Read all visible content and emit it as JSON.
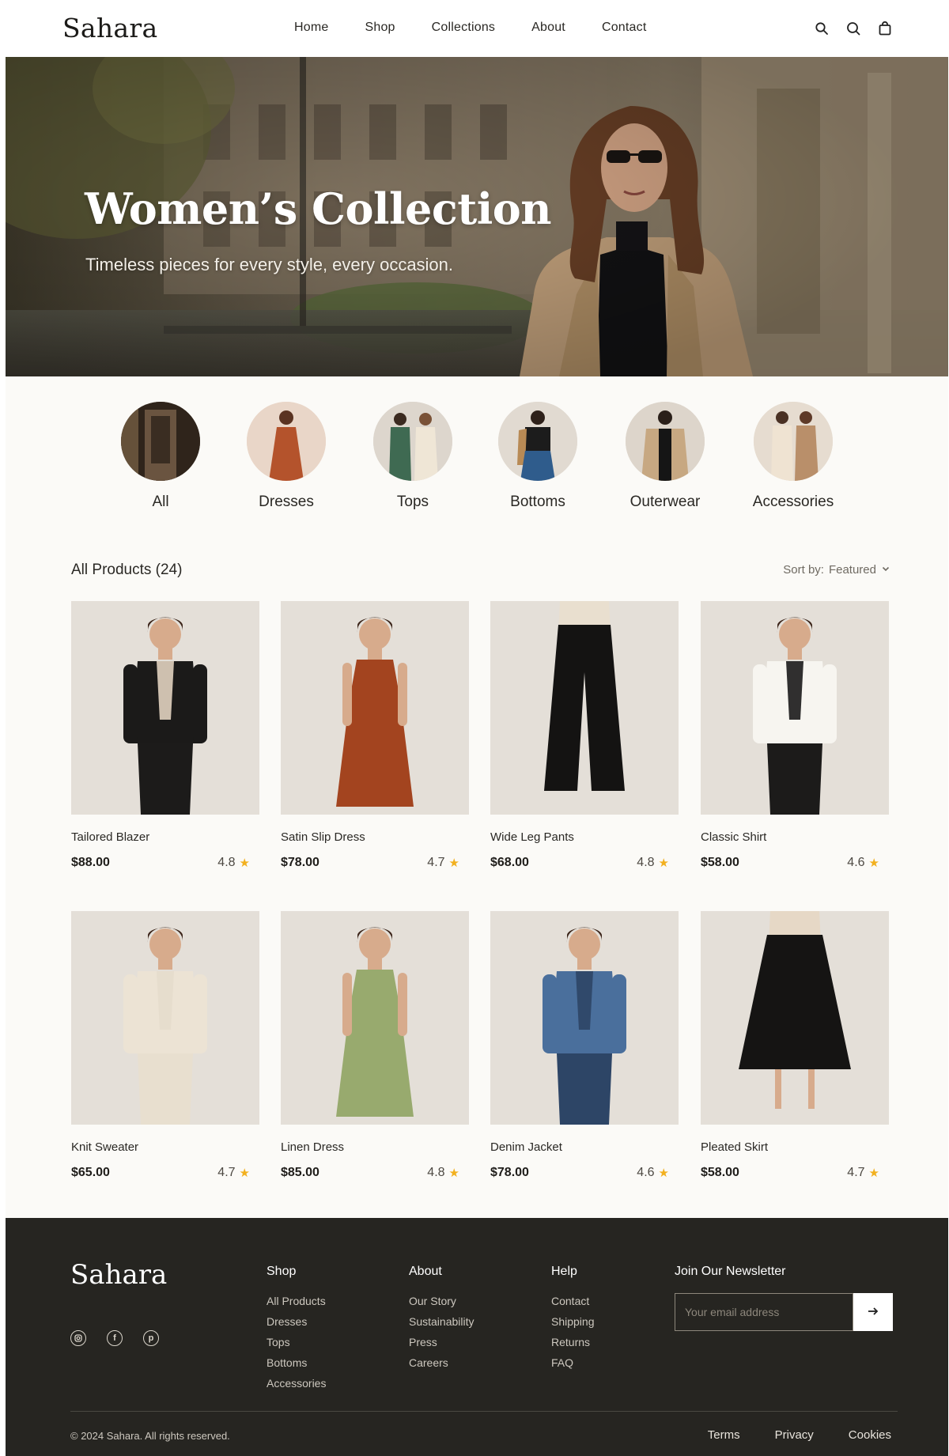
{
  "header": {
    "logo": "Sahara",
    "nav": [
      "Home",
      "Shop",
      "Collections",
      "About",
      "Contact"
    ],
    "icons": [
      "search-icon",
      "account-icon",
      "bag-icon"
    ]
  },
  "hero": {
    "title": "Women’s Collection",
    "subtitle": "Timeless pieces for every style, every occasion."
  },
  "categories": [
    {
      "label": "All",
      "image": "boutique-storefront",
      "color": "#4b3a2a"
    },
    {
      "label": "Dresses",
      "image": "rust-dress-model",
      "color": "#b4532c"
    },
    {
      "label": "Tops",
      "image": "green-and-cream-outfits",
      "color": "#3f6a52"
    },
    {
      "label": "Bottoms",
      "image": "blue-jeans-model",
      "color": "#2f5c8c"
    },
    {
      "label": "Outerwear",
      "image": "beige-coat-model",
      "color": "#c7a882"
    },
    {
      "label": "Accessories",
      "image": "neutral-outfits-model",
      "color": "#d8c4ab"
    }
  ],
  "products_header": {
    "count_label": "All Products (24)",
    "sort_label": "Sort by:",
    "sort_value": "Featured"
  },
  "products": [
    {
      "name": "Tailored Blazer",
      "price": "$88.00",
      "rating": "4.8",
      "image": "black-blazer-model",
      "color": "#1b1a19",
      "accent": "#e2d3c0"
    },
    {
      "name": "Satin Slip Dress",
      "price": "$78.00",
      "rating": "4.7",
      "image": "rust-slip-dress-model",
      "color": "#a3441f",
      "accent": "#a3441f"
    },
    {
      "name": "Wide Leg Pants",
      "price": "$68.00",
      "rating": "4.8",
      "image": "black-wide-pants",
      "color": "#141312",
      "accent": "#e9dfcf"
    },
    {
      "name": "Classic Shirt",
      "price": "$58.00",
      "rating": "4.6",
      "image": "white-shirt-model",
      "color": "#f7f5f0",
      "accent": "#1a1a1a"
    },
    {
      "name": "Knit Sweater",
      "price": "$65.00",
      "rating": "4.7",
      "image": "cream-sweater-model",
      "color": "#ece3d4",
      "accent": "#e5dccc"
    },
    {
      "name": "Linen Dress",
      "price": "$85.00",
      "rating": "4.8",
      "image": "sage-linen-dress-model",
      "color": "#98aa6e",
      "accent": "#98aa6e"
    },
    {
      "name": "Denim Jacket",
      "price": "$78.00",
      "rating": "4.6",
      "image": "denim-jacket-model",
      "color": "#4a6f9c",
      "accent": "#2d4566"
    },
    {
      "name": "Pleated Skirt",
      "price": "$58.00",
      "rating": "4.7",
      "image": "black-pleated-skirt",
      "color": "#151413",
      "accent": "#e6d8c6"
    }
  ],
  "footer": {
    "logo": "Sahara",
    "socials": [
      "instagram-icon",
      "facebook-icon",
      "pinterest-icon"
    ],
    "columns": [
      {
        "heading": "Shop",
        "links": [
          "All Products",
          "Dresses",
          "Tops",
          "Bottoms",
          "Accessories"
        ]
      },
      {
        "heading": "About",
        "links": [
          "Our Story",
          "Sustainability",
          "Press",
          "Careers"
        ]
      },
      {
        "heading": "Help",
        "links": [
          "Contact",
          "Shipping",
          "Returns",
          "FAQ"
        ]
      }
    ],
    "newsletter": {
      "heading": "Join Our Newsletter",
      "placeholder": "Your email address"
    },
    "copyright": "© 2024 Sahara. All rights reserved.",
    "legal": [
      "Terms",
      "Privacy",
      "Cookies"
    ]
  },
  "colors": {
    "background": "#fbfaf7",
    "footer": "#262521",
    "star": "#f2b01e",
    "text": "#1f1d1a"
  }
}
